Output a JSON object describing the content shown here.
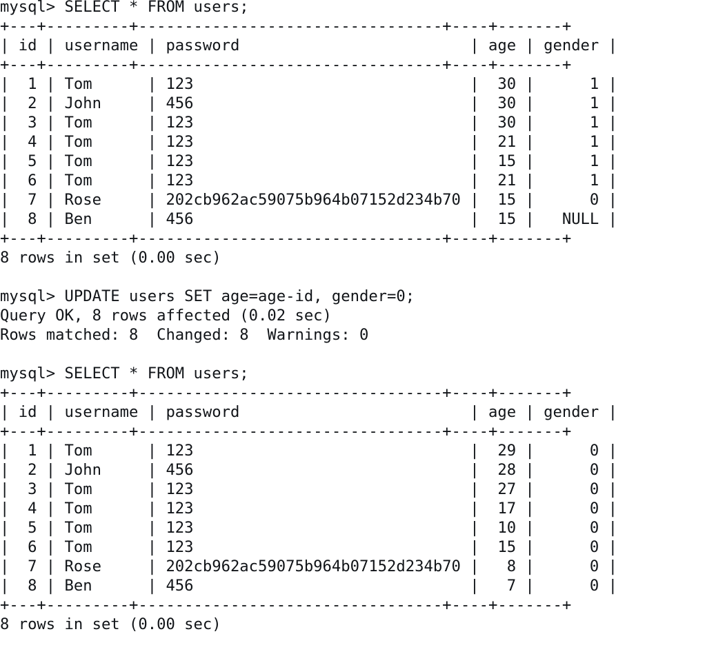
{
  "terminal": {
    "app": "mysql-client-terminal",
    "prompt": "mysql> ",
    "colors": {
      "background": "#ffffff",
      "foreground": "#111418"
    },
    "blocks": [
      {
        "kind": "command",
        "name": "select-users-before",
        "prompt": "mysql> ",
        "command": "SELECT * FROM users;"
      },
      {
        "kind": "table",
        "name": "users-table-before",
        "columns": [
          "id",
          "username",
          "password",
          "age",
          "gender"
        ],
        "widths": [
          4,
          10,
          34,
          5,
          8
        ],
        "aligns": [
          "right",
          "left",
          "left",
          "right",
          "right"
        ],
        "rows": [
          [
            "1",
            "Tom",
            "123",
            "30",
            "1"
          ],
          [
            "2",
            "John",
            "456",
            "30",
            "1"
          ],
          [
            "3",
            "Tom",
            "123",
            "30",
            "1"
          ],
          [
            "4",
            "Tom",
            "123",
            "21",
            "1"
          ],
          [
            "5",
            "Tom",
            "123",
            "15",
            "1"
          ],
          [
            "6",
            "Tom",
            "123",
            "21",
            "1"
          ],
          [
            "7",
            "Rose",
            "202cb962ac59075b964b07152d234b70",
            "15",
            "0"
          ],
          [
            "8",
            "Ben",
            "456",
            "15",
            "NULL"
          ]
        ]
      },
      {
        "kind": "status",
        "name": "rows-in-set-before",
        "text": "8 rows in set (0.00 sec)"
      },
      {
        "kind": "blank",
        "name": "blank-line-1"
      },
      {
        "kind": "command",
        "name": "update-users-command",
        "prompt": "mysql> ",
        "command": "UPDATE users SET age=age-id, gender=0;"
      },
      {
        "kind": "status",
        "name": "query-ok-status",
        "text": "Query OK, 8 rows affected (0.02 sec)"
      },
      {
        "kind": "status",
        "name": "rows-matched-status",
        "text": "Rows matched: 8  Changed: 8  Warnings: 0"
      },
      {
        "kind": "blank",
        "name": "blank-line-2"
      },
      {
        "kind": "command",
        "name": "select-users-after",
        "prompt": "mysql> ",
        "command": "SELECT * FROM users;"
      },
      {
        "kind": "table",
        "name": "users-table-after",
        "columns": [
          "id",
          "username",
          "password",
          "age",
          "gender"
        ],
        "widths": [
          4,
          10,
          34,
          5,
          8
        ],
        "aligns": [
          "right",
          "left",
          "left",
          "right",
          "right"
        ],
        "rows": [
          [
            "1",
            "Tom",
            "123",
            "29",
            "0"
          ],
          [
            "2",
            "John",
            "456",
            "28",
            "0"
          ],
          [
            "3",
            "Tom",
            "123",
            "27",
            "0"
          ],
          [
            "4",
            "Tom",
            "123",
            "17",
            "0"
          ],
          [
            "5",
            "Tom",
            "123",
            "10",
            "0"
          ],
          [
            "6",
            "Tom",
            "123",
            "15",
            "0"
          ],
          [
            "7",
            "Rose",
            "202cb962ac59075b964b07152d234b70",
            "8",
            "0"
          ],
          [
            "8",
            "Ben",
            "456",
            "7",
            "0"
          ]
        ]
      },
      {
        "kind": "status",
        "name": "rows-in-set-after",
        "text": "8 rows in set (0.00 sec)"
      }
    ]
  }
}
